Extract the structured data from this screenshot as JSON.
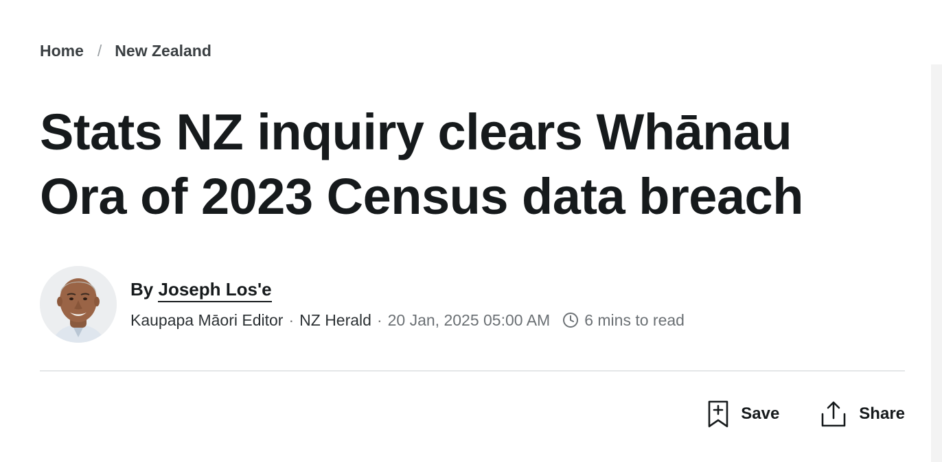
{
  "breadcrumb": {
    "items": [
      "Home",
      "New Zealand"
    ],
    "separator": "/"
  },
  "article": {
    "headline": "Stats NZ inquiry clears Whānau Ora of 2023 Census data breach"
  },
  "author": {
    "by_prefix": "By",
    "name": "Joseph Los'e",
    "role": "Kaupapa Māori Editor",
    "publication": "NZ Herald",
    "date": "20 Jan, 2025 05:00 AM",
    "read_time": "6 mins to read",
    "avatar_icon": "author-photo"
  },
  "actions": {
    "save_label": "Save",
    "save_icon": "bookmark-plus-icon",
    "share_label": "Share",
    "share_icon": "share-icon"
  },
  "colors": {
    "text": "#161a1c",
    "muted": "#6b7074",
    "divider": "#e4e6e7"
  }
}
